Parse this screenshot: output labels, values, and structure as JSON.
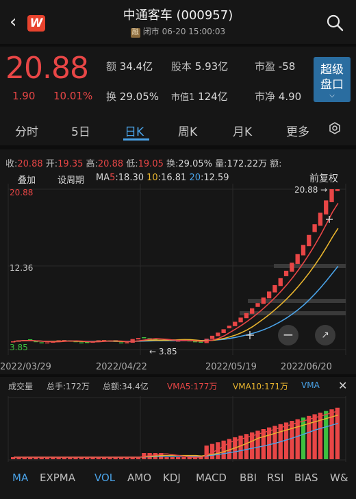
{
  "header": {
    "title": "中通客车 (000957)",
    "badge": "融",
    "status": "闭市 06-20 15:00:03",
    "logo": "W"
  },
  "quote": {
    "price": "20.88",
    "change": "1.90",
    "change_pct": "10.01%",
    "amount_label": "额",
    "amount": "34.4亿",
    "shares_label": "股本",
    "shares": "5.93亿",
    "pe_label": "市盈",
    "pe": "-58",
    "turnover_label": "换",
    "turnover": "29.05%",
    "mktcap_label": "市值1",
    "mktcap": "124亿",
    "pb_label": "市净",
    "pb": "4.90",
    "super_btn_line1": "超级",
    "super_btn_line2": "盘口"
  },
  "tabs": [
    "分时",
    "5日",
    "日K",
    "周K",
    "月K",
    "更多"
  ],
  "active_tab": "日K",
  "info_row": {
    "close_label": "收:",
    "close": "20.88",
    "open_label": "开:",
    "open": "19.35",
    "high_label": "高:",
    "high": "20.88",
    "low_label": "低:",
    "low": "19.05",
    "turn_label": "换:",
    "turn": "29.05%",
    "vol_label": "量:",
    "vol": "172.22万",
    "amt_label": "额:"
  },
  "chart_controls": {
    "overlay": "叠加",
    "period": "设周期",
    "ma_prefix": "MA",
    "ma5_label": "5",
    "ma5": ":18.30",
    "ma10_label": "10",
    "ma10": ":16.81",
    "ma20_label": "20",
    "ma20": ":12.59",
    "adjust": "前复权"
  },
  "chart_data": {
    "type": "candlestick",
    "y_labels": [
      "20.88",
      "12.36",
      "3.85"
    ],
    "ylim": [
      3.85,
      20.88
    ],
    "x_ticks": [
      "2022/03/29",
      "2022/04/22",
      "2022/05/19",
      "2022/06/20"
    ],
    "annotations": [
      "20.88",
      "3.85"
    ],
    "ma_colors": {
      "ma5": "#e84646",
      "ma10": "#e8b42e",
      "ma20": "#4aa3e8"
    },
    "up_color": "#e84646",
    "down_color": "#3fbf3f"
  },
  "volume": {
    "label": "成交量",
    "total_hands": "总手:172万",
    "total_amount": "总额:34.4亿",
    "vma5": "VMA5:177万",
    "vma10": "VMA10:171万",
    "vma20": "VMA"
  },
  "indicators": [
    "MA",
    "EXPMA",
    "VOL",
    "AMO",
    "KDJ",
    "MACD",
    "BBI",
    "RSI",
    "BIAS",
    "W&"
  ],
  "active_indicators": [
    "MA",
    "VOL"
  ]
}
